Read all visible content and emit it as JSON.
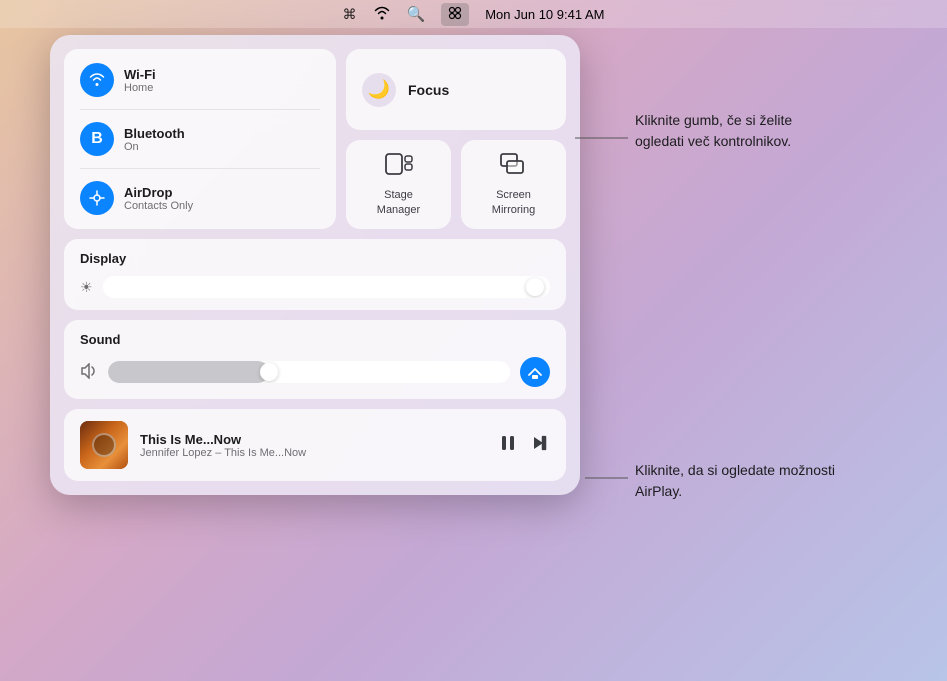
{
  "menubar": {
    "wifi_icon": "📶",
    "search_icon": "🔍",
    "control_center_icon": "⊟",
    "datetime": "Mon Jun 10  9:41 AM"
  },
  "control_center": {
    "network_tile": {
      "wifi": {
        "label": "Wi-Fi",
        "sublabel": "Home",
        "icon": "wifi"
      },
      "bluetooth": {
        "label": "Bluetooth",
        "sublabel": "On",
        "icon": "bluetooth"
      },
      "airdrop": {
        "label": "AirDrop",
        "sublabel": "Contacts Only",
        "icon": "airdrop"
      }
    },
    "focus": {
      "label": "Focus",
      "icon": "🌙"
    },
    "stage_manager": {
      "label": "Stage\nManager"
    },
    "screen_mirroring": {
      "label": "Screen\nMirroring"
    },
    "display": {
      "header": "Display",
      "slider_icon": "☀"
    },
    "sound": {
      "header": "Sound",
      "slider_icon": "🔈"
    },
    "now_playing": {
      "title": "This Is Me...Now",
      "artist": "Jennifer Lopez – This Is Me...Now"
    }
  },
  "callouts": {
    "top": {
      "text": "Kliknite gumb, če si želite ogledati več kontrolnikov."
    },
    "bottom": {
      "text": "Kliknite, da si ogledate možnosti AirPlay."
    }
  }
}
